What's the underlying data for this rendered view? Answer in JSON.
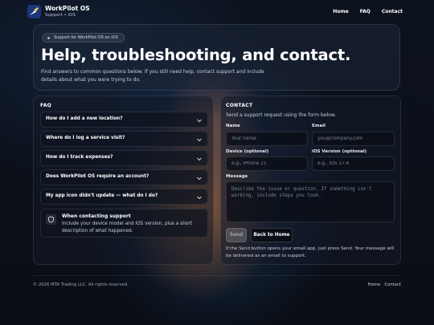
{
  "brand": {
    "name": "WorkPilot OS",
    "subtitle": "Support • iOS"
  },
  "nav": {
    "items": [
      "Home",
      "FAQ",
      "Contact"
    ]
  },
  "hero": {
    "badge": "Support for WorkPilot OS on iOS",
    "title": "Help, troubleshooting, and contact.",
    "description": "Find answers to common questions below. If you still need help, contact support and include details about what you were trying to do."
  },
  "faq": {
    "heading": "FAQ",
    "questions": [
      "How do I add a new location?",
      "Where do I log a service visit?",
      "How do I track expenses?",
      "Does WorkPilot OS require an account?",
      "My app icon didn't update — what do I do?"
    ],
    "notice": {
      "title": "When contacting support",
      "text": "Include your device model and iOS version, plus a short description of what happened."
    }
  },
  "contact": {
    "heading": "CONTACT",
    "description": "Send a support request using the form below.",
    "name_label": "Name",
    "name_placeholder": "Your name",
    "email_label": "Email",
    "email_placeholder": "you@company.com",
    "device_label": "Device (optional)",
    "device_placeholder": "e.g., iPhone 15",
    "ios_label": "iOS Version (optional)",
    "ios_placeholder": "e.g., iOS 17.4",
    "message_label": "Message",
    "message_placeholder": "Describe the issue or question. If something isn't working, include steps you took.",
    "send_label": "Send",
    "home_label": "Back to Home",
    "note": "If the Send button opens your email app, just press Send. Your message will be delivered as an email to support."
  },
  "footer": {
    "copyright": "© 2026 MTA Trading LLC. All rights reserved.",
    "links": [
      "Home",
      "Contact"
    ],
    "separator": "·"
  }
}
